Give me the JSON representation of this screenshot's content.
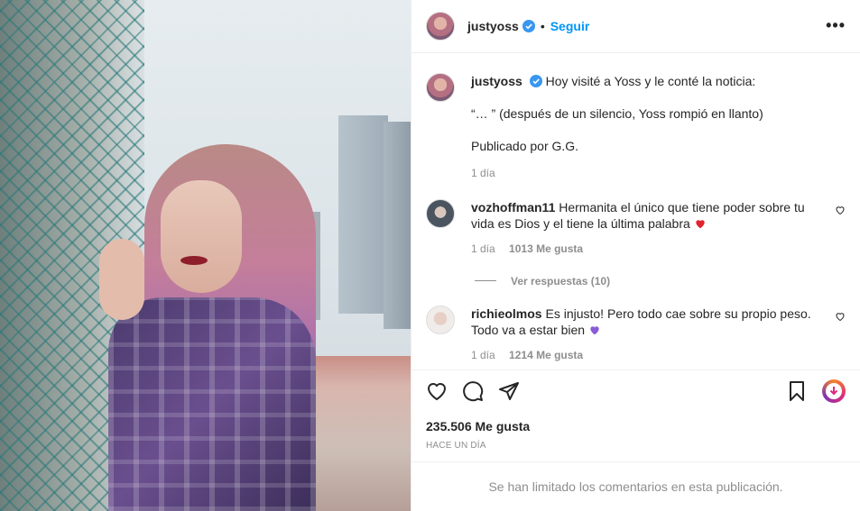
{
  "header": {
    "username": "justyoss",
    "separator": "•",
    "follow_label": "Seguir",
    "more_label": "•••"
  },
  "caption": {
    "username": "justyoss",
    "line1": "Hoy visité a Yoss y le conté la noticia:",
    "line2": "“… ” (después de un silencio, Yoss rompió en llanto)",
    "line3": "Publicado por G.G.",
    "time": "1 día"
  },
  "comments": [
    {
      "username": "vozhoffman11",
      "text": "Hermanita el único que tiene poder sobre tu vida es Dios y el tiene la última palabra",
      "emoji": "red-heart-emoji",
      "time": "1 día",
      "likes": "1013 Me gusta",
      "replies_label": "Ver respuestas (10)"
    },
    {
      "username": "richieolmos",
      "text": "Es injusto! Pero todo cae sobre su propio peso. Todo va a estar bien",
      "emoji": "purple-heart-emoji",
      "time": "1 día",
      "likes": "1214 Me gusta"
    }
  ],
  "post": {
    "likes": "235.506 Me gusta",
    "time_ago": "HACE UN DÍA",
    "comments_limited": "Se han limitado los comentarios en esta publicación."
  },
  "colors": {
    "accent": "#0095f6",
    "muted": "#8e8e8e",
    "text": "#262626",
    "verified": "#3897f0"
  }
}
